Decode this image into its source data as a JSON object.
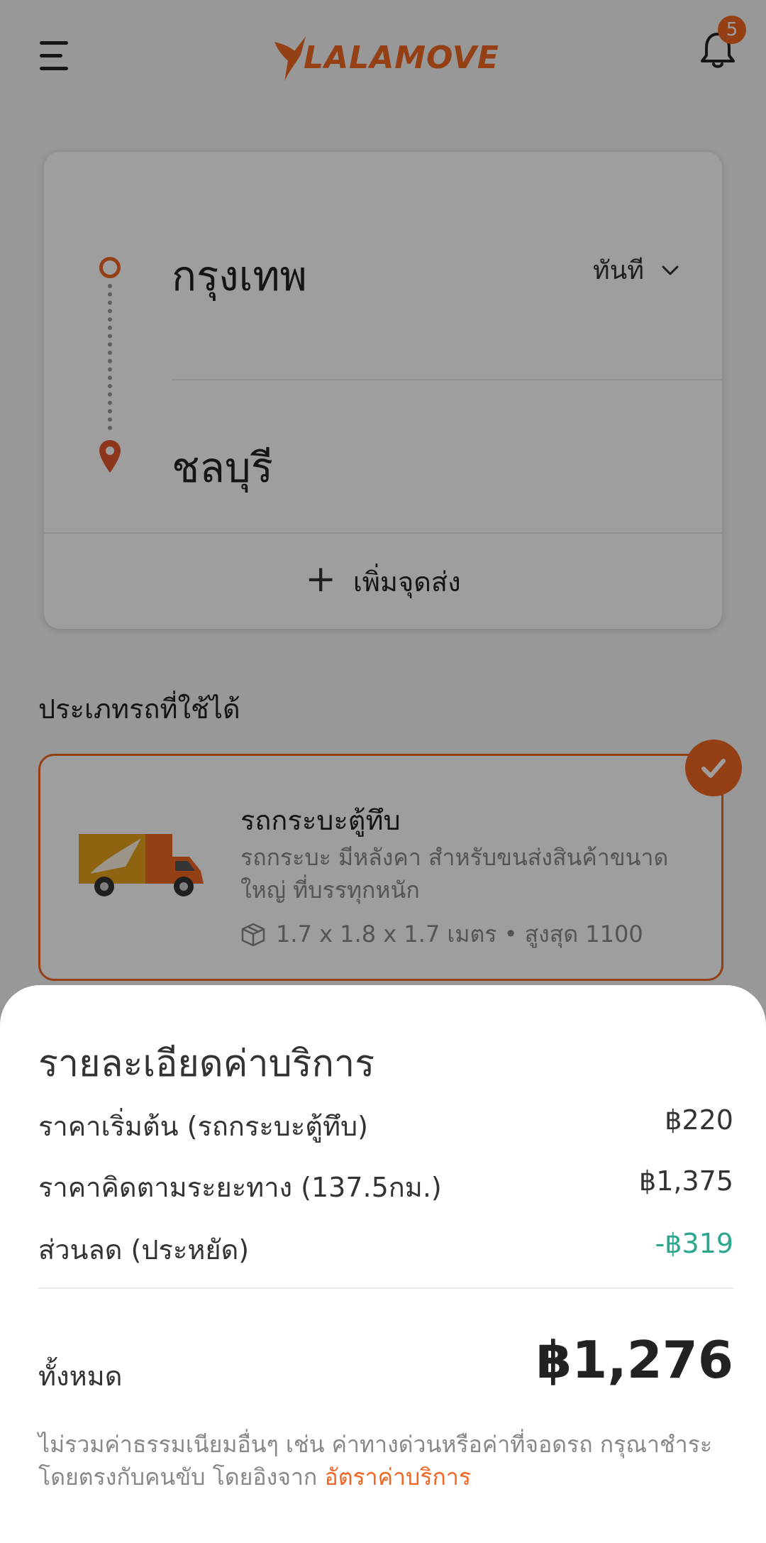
{
  "header": {
    "brand": "LALAMOVE",
    "notification_count": "5",
    "accent_color": "#f16622"
  },
  "route": {
    "origin": "กรุงเทพ",
    "destination": "ชลบุรี",
    "time_option": "ทันที",
    "add_stop_label": "เพิ่มจุดส่ง"
  },
  "vehicles": {
    "section_title": "ประเภทรถที่ใช้ได้",
    "selected": {
      "name": "รถกระบะตู้ทึบ",
      "description": "รถกระบะ มีหลังคา สำหรับขนส่งสินค้าขนาดใหญ่ ที่บรรทุกหนัก",
      "specs": "1.7 x 1.8 x 1.7 เมตร • สูงสุด 1100"
    }
  },
  "fee_sheet": {
    "title": "รายละเอียดค่าบริการ",
    "items": [
      {
        "label": "ราคาเริ่มต้น (รถกระบะตู้ทึบ)",
        "value": "฿220"
      },
      {
        "label": "ราคาคิดตามระยะทาง (137.5กม.)",
        "value": "฿1,375"
      },
      {
        "label": "ส่วนลด (ประหยัด)",
        "value": "-฿319"
      }
    ],
    "total_label": "ทั้งหมด",
    "total_value": "฿1,276",
    "footnote": "ไม่รวมค่าธรรมเนียมอื่นๆ เช่น ค่าทางด่วนหรือค่าที่จอดรถ กรุณาชำระโดยตรงกับคนขับ โดยอิงจาก ",
    "footnote_link": "อัตราค่าบริการ",
    "discount_color": "#2aa78d"
  }
}
